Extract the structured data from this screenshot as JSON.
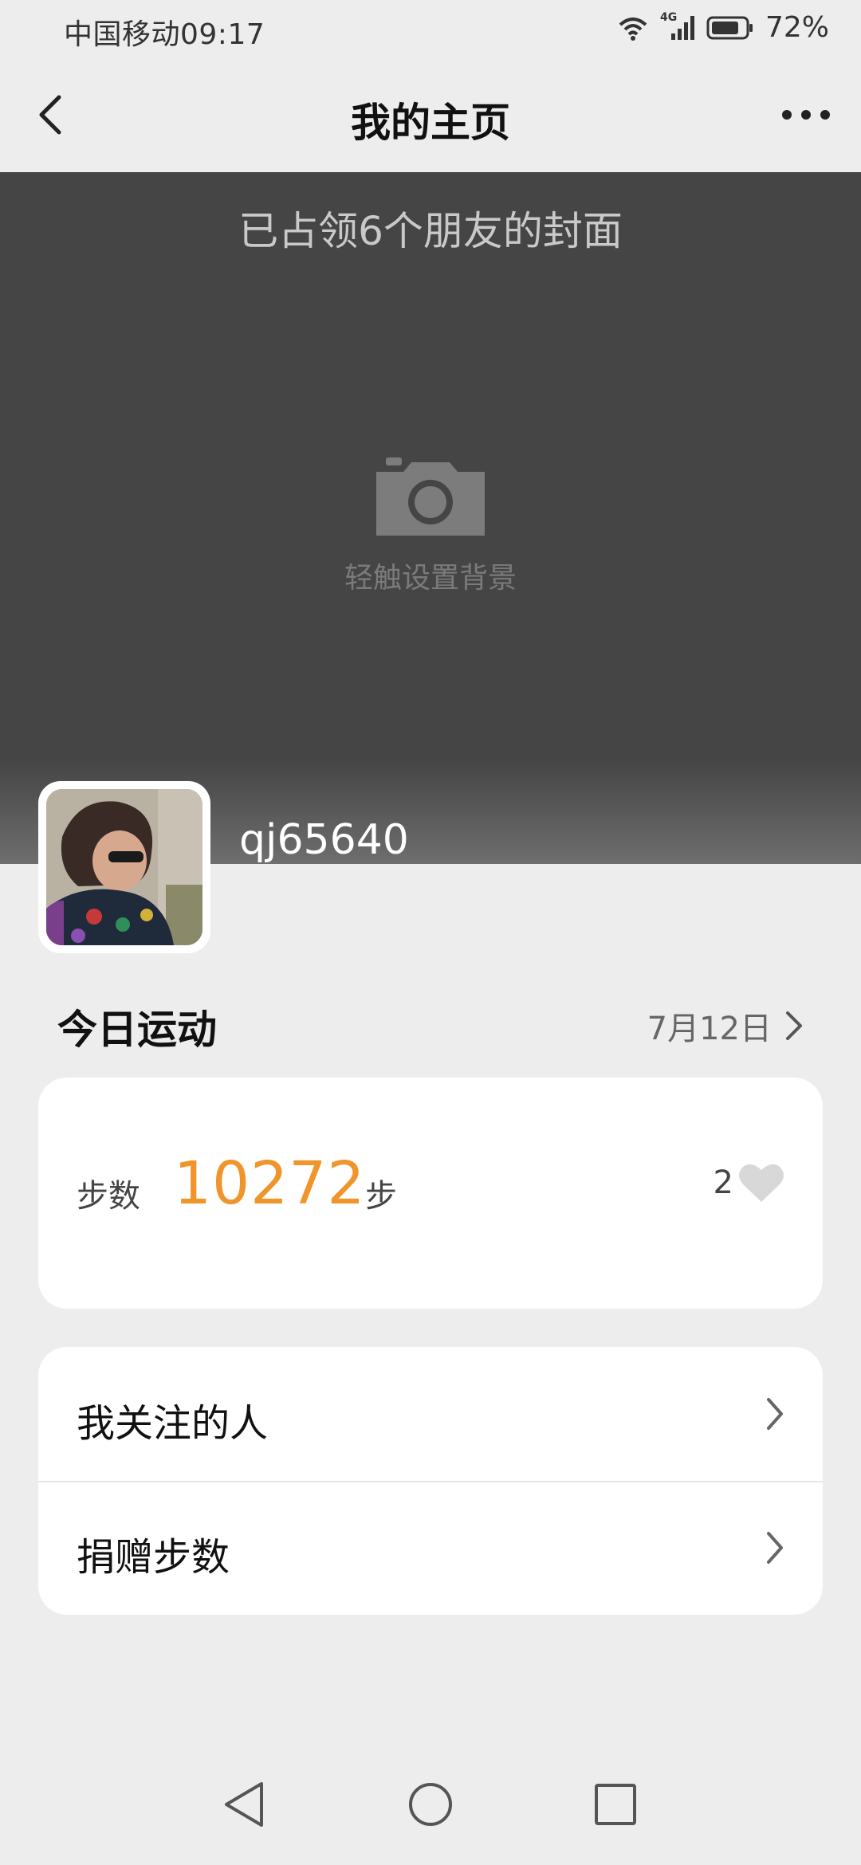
{
  "status_bar": {
    "carrier_time": "中国移动09:17",
    "network": "4G",
    "battery": "72%"
  },
  "nav": {
    "title": "我的主页"
  },
  "cover": {
    "title": "已占领6个朋友的封面",
    "hint": "轻触设置背景"
  },
  "profile": {
    "username": "qj65640"
  },
  "today": {
    "title": "今日运动",
    "date": "7月12日"
  },
  "steps": {
    "label": "步数",
    "value": "10272",
    "unit": "步",
    "likes": "2"
  },
  "menu": {
    "items": [
      {
        "label": "我关注的人"
      },
      {
        "label": "捐赠步数"
      }
    ]
  },
  "colors": {
    "accent": "#f0952b",
    "cover": "#454545",
    "background": "#ededed"
  }
}
